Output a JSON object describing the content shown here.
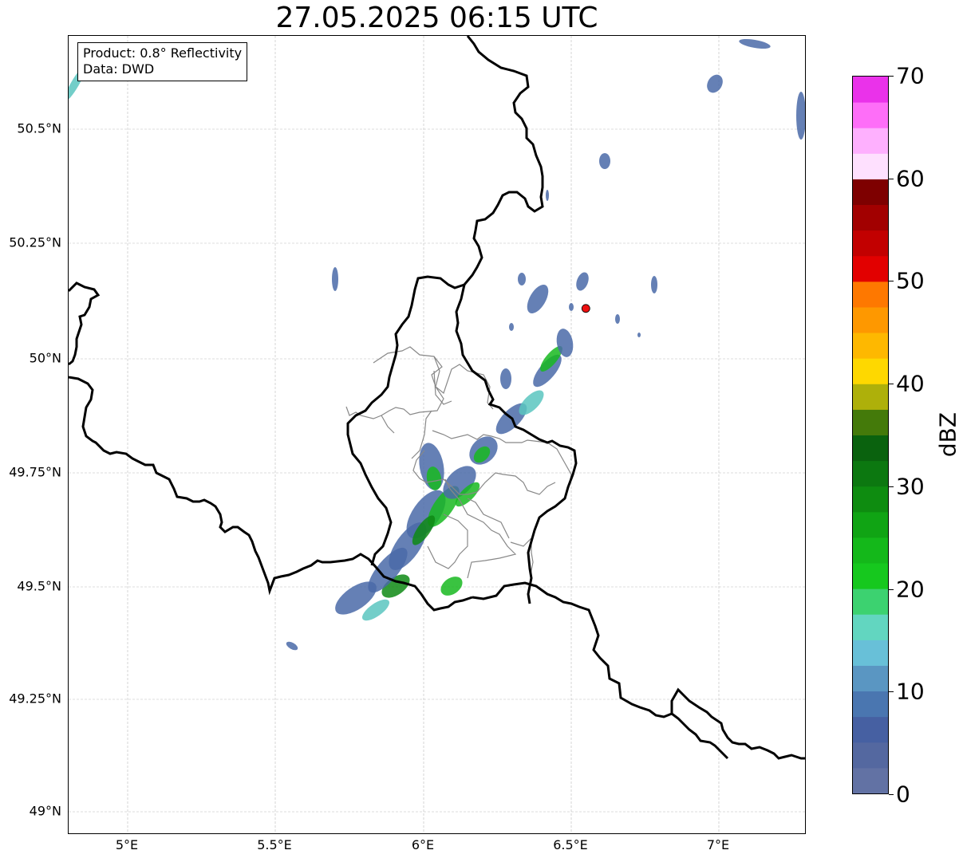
{
  "title": "27.05.2025 06:15 UTC",
  "info": {
    "product": "Product: 0.8° Reflectivity",
    "data": "Data: DWD"
  },
  "lat_labels": [
    "50.5°N",
    "50.25°N",
    "50°N",
    "49.75°N",
    "49.5°N",
    "49.25°N",
    "49°N"
  ],
  "lon_labels": [
    "5°E",
    "5.5°E",
    "6°E",
    "6.5°E",
    "7°E"
  ],
  "colorbar": {
    "label": "dBZ",
    "ticks": [
      "0",
      "10",
      "20",
      "30",
      "40",
      "50",
      "60",
      "70"
    ],
    "colors": [
      "#6272a4",
      "#5468a0",
      "#4660a2",
      "#4a76b0",
      "#5a96c2",
      "#68c0d8",
      "#62d6c0",
      "#3cd270",
      "#16c81e",
      "#14b81a",
      "#10a414",
      "#0e8c10",
      "#0c7810",
      "#0a620e",
      "#447a0a",
      "#aeb00a",
      "#fed800",
      "#feb800",
      "#fe9800",
      "#fe7800",
      "#e20000",
      "#c20000",
      "#a20000",
      "#7e0000",
      "#fee0fe",
      "#feb0fe",
      "#fe6ef8",
      "#ea32ea"
    ]
  },
  "radar_location": {
    "lon": 6.55,
    "lat": 50.11
  }
}
